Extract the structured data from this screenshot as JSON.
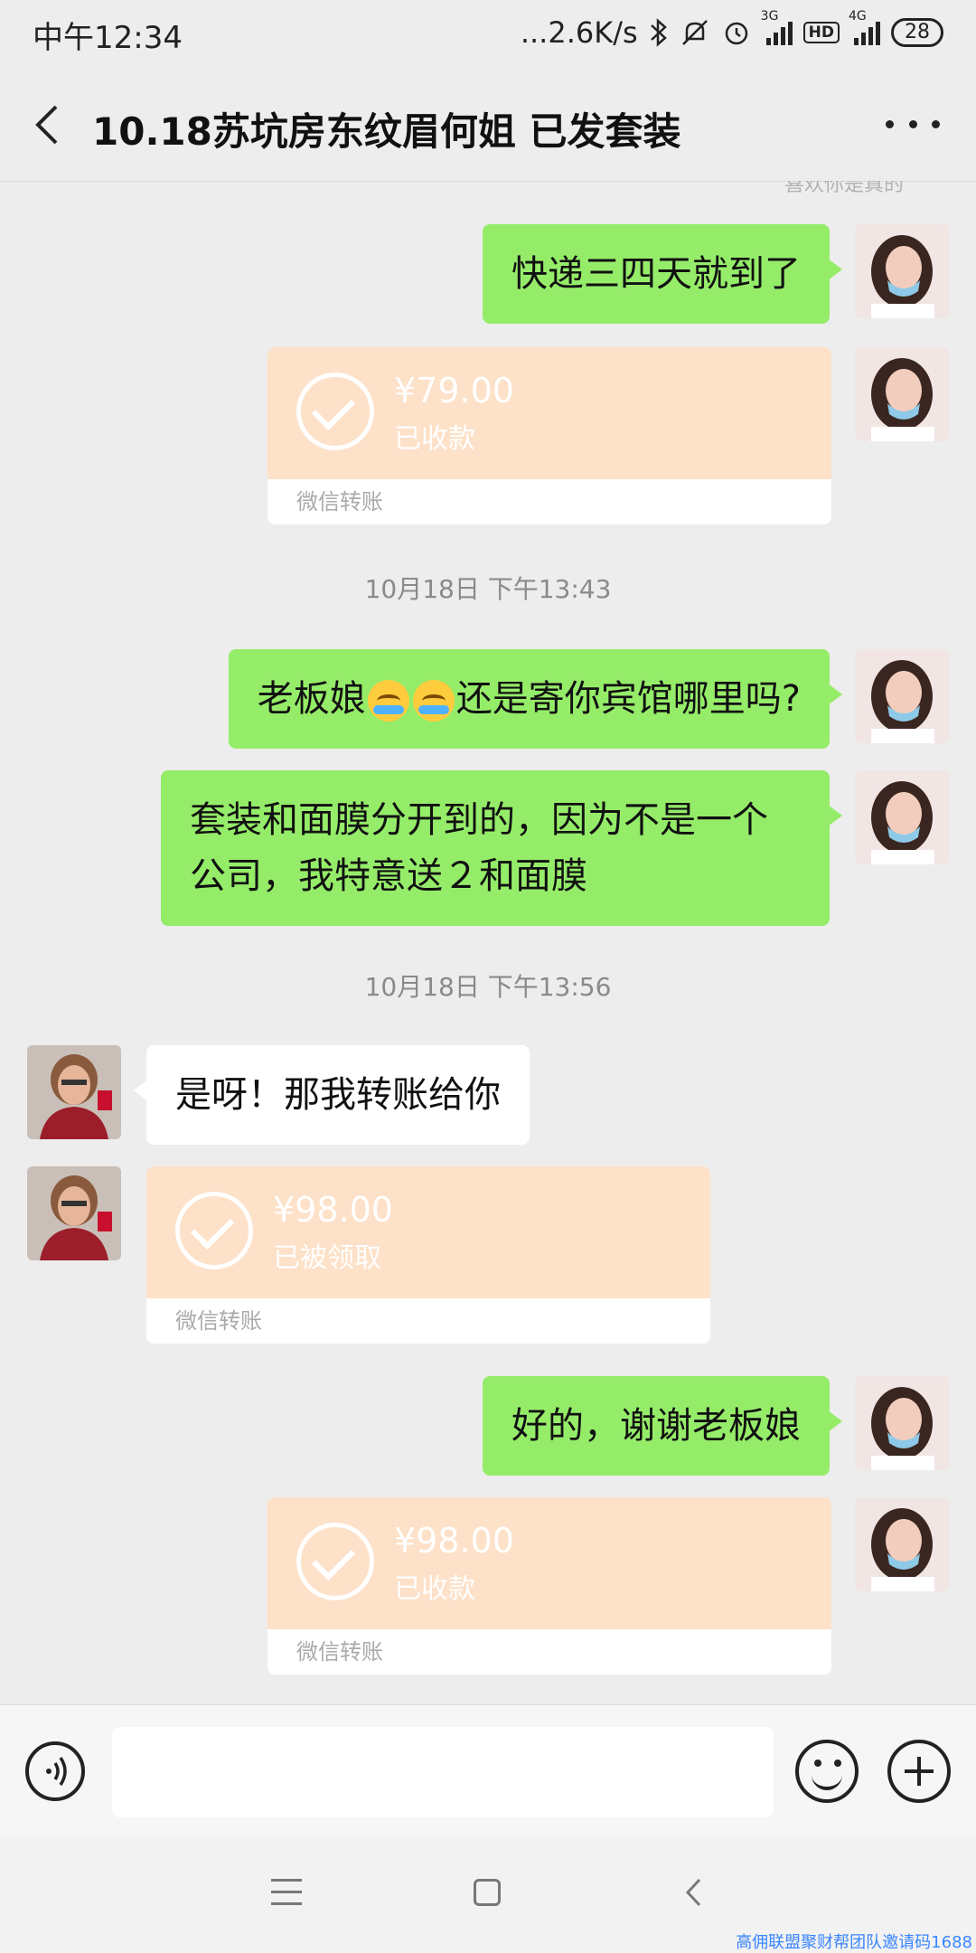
{
  "status_bar": {
    "time": "中午12:34",
    "net_speed": "...2.6K/s",
    "sim1_label": "3G",
    "hd_label": "HD",
    "sim2_label": "4G",
    "battery": "28"
  },
  "header": {
    "title": "10.18苏坑房东纹眉何姐  已发套装"
  },
  "chat": {
    "faded_top_text": "喜欢你是真的",
    "messages": [
      {
        "text": "快递三四天就到了"
      },
      {
        "amount": "¥79.00",
        "status": "已收款",
        "footer": "微信转账"
      },
      {
        "timestamp": "10月18日 下午13:43"
      },
      {
        "text_a": "老板娘",
        "text_b": "还是寄你宾馆哪里吗?"
      },
      {
        "text": "套装和面膜分开到的，因为不是一个公司，我特意送２和面膜"
      },
      {
        "timestamp": "10月18日 下午13:56"
      },
      {
        "text": "是呀！那我转账给你"
      },
      {
        "amount": "¥98.00",
        "status": "已被领取",
        "footer": "微信转账"
      },
      {
        "text": "好的，谢谢老板娘"
      },
      {
        "amount": "¥98.00",
        "status": "已收款",
        "footer": "微信转账"
      }
    ]
  },
  "watermark": "高佣联盟聚财帮团队邀请码1688",
  "colors": {
    "background": "#ededed",
    "my_bubble": "#95ec69",
    "other_bubble": "#ffffff",
    "transfer_card": "#fde1c8"
  }
}
